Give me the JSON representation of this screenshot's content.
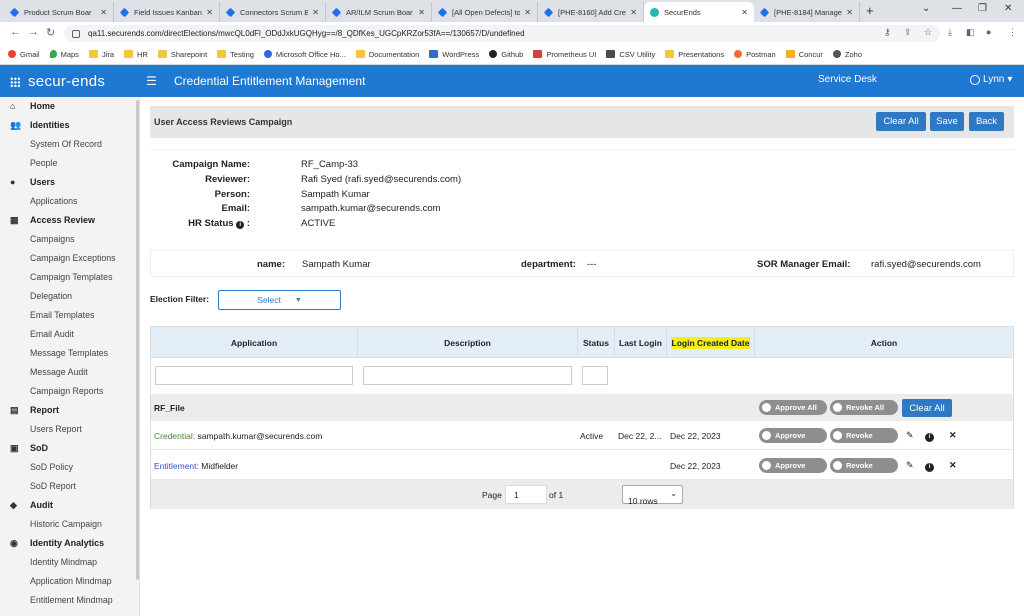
{
  "browser": {
    "tabs": [
      {
        "label": "Product Scrum Boar"
      },
      {
        "label": "Field Issues Kanban B"
      },
      {
        "label": "Connectors Scrum Bo"
      },
      {
        "label": "AR/ILM Scrum Boar"
      },
      {
        "label": "[All Open Defects] to"
      },
      {
        "label": "[PHE-8160] Add Cre"
      },
      {
        "label": "SecurEnds"
      },
      {
        "label": "[PHE-8184] Manage"
      }
    ],
    "url": "qa11.securends.com/directElections/mwcQL0dFl_ODdJxkUGQHyg==/8_QDfKes_UGCpKRZor53fA==/130657/D/undefined",
    "bookmarks": [
      "Gmail",
      "Maps",
      "Jira",
      "HR",
      "Sharepoint",
      "Testing",
      "Microsoft Office Ho...",
      "Documentation",
      "WordPress",
      "Github",
      "Prometheus UI",
      "CSV Utility",
      "Presentations",
      "Postman",
      "Concur",
      "Zoho"
    ]
  },
  "header": {
    "logo": "secur-ends",
    "title": "Credential Entitlement Management",
    "service_desk": "Service Desk",
    "user": "Lynn"
  },
  "sidebar": {
    "items": [
      {
        "label": "Home",
        "type": "sec",
        "icon": "home-icon",
        "glyph": "⌂"
      },
      {
        "label": "Identities",
        "type": "sec",
        "icon": "people-icon",
        "glyph": "👥"
      },
      {
        "label": "System Of Record",
        "type": "sub"
      },
      {
        "label": "People",
        "type": "sub"
      },
      {
        "label": "Users",
        "type": "sec",
        "icon": "user-icon",
        "glyph": "●"
      },
      {
        "label": "Applications",
        "type": "sub"
      },
      {
        "label": "Access Review",
        "type": "sec",
        "icon": "grid-icon",
        "glyph": "▦"
      },
      {
        "label": "Campaigns",
        "type": "sub"
      },
      {
        "label": "Campaign Exceptions",
        "type": "sub"
      },
      {
        "label": "Campaign Templates",
        "type": "sub"
      },
      {
        "label": "Delegation",
        "type": "sub"
      },
      {
        "label": "Email Templates",
        "type": "sub"
      },
      {
        "label": "Email Audit",
        "type": "sub"
      },
      {
        "label": "Message Templates",
        "type": "sub"
      },
      {
        "label": "Message Audit",
        "type": "sub"
      },
      {
        "label": "Campaign Reports",
        "type": "sub"
      },
      {
        "label": "Report",
        "type": "sec",
        "icon": "file-icon",
        "glyph": "▤"
      },
      {
        "label": "Users Report",
        "type": "sub"
      },
      {
        "label": "SoD",
        "type": "sec",
        "icon": "table-icon",
        "glyph": "▣"
      },
      {
        "label": "SoD Policy",
        "type": "sub"
      },
      {
        "label": "SoD Report",
        "type": "sub"
      },
      {
        "label": "Audit",
        "type": "sec",
        "icon": "shield-icon",
        "glyph": "◆"
      },
      {
        "label": "Historic Campaign",
        "type": "sub"
      },
      {
        "label": "Identity Analytics",
        "type": "sec",
        "icon": "analytics-icon",
        "glyph": "◉"
      },
      {
        "label": "Identity Mindmap",
        "type": "sub"
      },
      {
        "label": "Application Mindmap",
        "type": "sub"
      },
      {
        "label": "Entitlement Mindmap",
        "type": "sub"
      }
    ]
  },
  "panel": {
    "title": "User Access Reviews Campaign",
    "clear_all": "Clear All",
    "save": "Save",
    "back": "Back"
  },
  "info": {
    "campaign_name_label": "Campaign Name:",
    "campaign_name": "RF_Camp-33",
    "reviewer_label": "Reviewer:",
    "reviewer": "Rafi Syed (rafi.syed@securends.com)",
    "person_label": "Person:",
    "person": "Sampath Kumar",
    "email_label": "Email:",
    "email": "sampath.kumar@securends.com",
    "hr_status_label": "HR Status",
    "hr_status": "ACTIVE"
  },
  "person_row": {
    "name_label": "name:",
    "name": "Sampath Kumar",
    "department_label": "department:",
    "department": "---",
    "sor_label": "SOR Manager Email:",
    "sor_email": "rafi.syed@securends.com"
  },
  "election_filter": {
    "label": "Election Filter:",
    "value": "Select"
  },
  "table": {
    "headers": [
      "Application",
      "Description",
      "Status",
      "Last Login",
      "Login Created Date",
      "Action"
    ],
    "group": {
      "name": "RF_File",
      "approve_all": "Approve All",
      "revoke_all": "Revoke All",
      "clear_all": "Clear All"
    },
    "rows": [
      {
        "type": "Credential:",
        "value": "sampath.kumar@securends.com",
        "status": "Active",
        "last_login": "Dec 22, 2...",
        "created": "Dec 22, 2023",
        "approve": "Approve",
        "revoke": "Revoke"
      },
      {
        "type": "Entitlement:",
        "value": "Midfielder",
        "status": "",
        "last_login": "",
        "created": "Dec 22, 2023",
        "approve": "Approve",
        "revoke": "Revoke"
      }
    ],
    "pager": {
      "page_label": "Page",
      "page": "1",
      "of": "of 1",
      "rows": "10 rows"
    }
  }
}
